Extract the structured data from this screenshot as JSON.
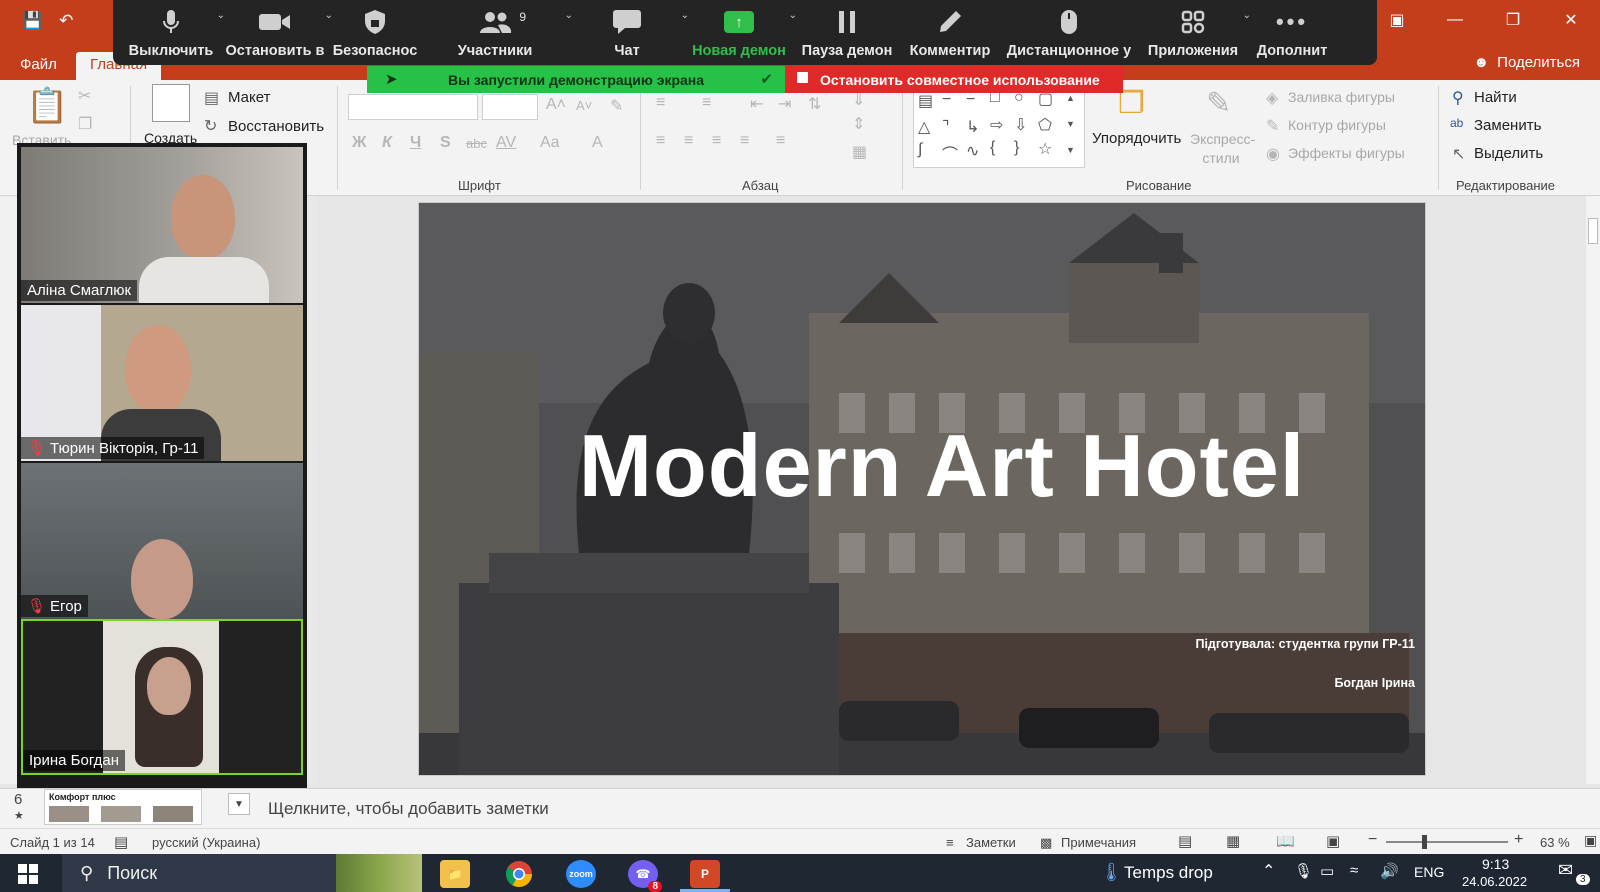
{
  "window": {
    "title_bar_color": "#c43e1c",
    "qat_icons": [
      "save-icon",
      "undo-icon"
    ],
    "controls": [
      "ribbon-display-icon",
      "minimize-icon",
      "restore-icon",
      "close-icon"
    ]
  },
  "zoom_toolbar": {
    "buttons": [
      {
        "label": "Выключить",
        "icon": "microphone-icon"
      },
      {
        "label": "Остановить в",
        "icon": "video-camera-icon"
      },
      {
        "label": "Безопаснос",
        "icon": "shield-icon"
      },
      {
        "label": "Участники",
        "icon": "participants-icon",
        "count": "9"
      },
      {
        "label": "Чат",
        "icon": "chat-icon"
      },
      {
        "label": "Новая демон",
        "icon": "share-screen-icon"
      },
      {
        "label": "Пауза демон",
        "icon": "pause-icon"
      },
      {
        "label": "Комментир",
        "icon": "annotate-pencil-icon"
      },
      {
        "label": "Дистанционное у",
        "icon": "remote-control-mouse-icon"
      },
      {
        "label": "Приложения",
        "icon": "apps-icon"
      },
      {
        "label": "Дополнит",
        "icon": "more-icon"
      }
    ]
  },
  "share_banner": {
    "sharing_text": "Вы запустили демонстрацию экрана",
    "stop_text": "Остановить совместное использование"
  },
  "ribbon_tabs": [
    "Файл",
    "Главная"
  ],
  "share_label": "Поделиться",
  "ribbon": {
    "clipboard": {
      "paste": "Вставить"
    },
    "slides": {
      "new": "Создать",
      "layout": "Макет",
      "reset": "Восстановить"
    },
    "font_group_label": "Шрифт",
    "paragraph_group_label": "Абзац",
    "font_buttons": [
      "Ж",
      "К",
      "Ч",
      "S",
      "abc",
      "AV",
      "Aa",
      "A"
    ],
    "drawing": {
      "arrange": "Упорядочить",
      "quick_styles": "Экспресс-стили",
      "fill": "Заливка фигуры",
      "outline": "Контур фигуры",
      "effects": "Эффекты фигуры",
      "group_label": "Рисование"
    },
    "editing": {
      "find": "Найти",
      "replace": "Заменить",
      "select": "Выделить",
      "group_label": "Редактирование"
    }
  },
  "participants": [
    {
      "name": "Аліна Смаглюк",
      "muted": false,
      "active": false
    },
    {
      "name": "Тюрин Вікторія, Гр-11",
      "muted": true,
      "active": false
    },
    {
      "name": "Егор",
      "muted": true,
      "active": false
    },
    {
      "name": "Ірина Богдан",
      "muted": false,
      "active": true
    }
  ],
  "slide": {
    "title": "Modern Art Hotel",
    "credit_line1": "Підготувала: студентка групи ГР-11",
    "credit_line2": "Богдан Ірина"
  },
  "thumbnail": {
    "number": "6",
    "caption": "Комфорт плюс"
  },
  "notes_placeholder": "Щелкните, чтобы добавить заметки",
  "status_bar": {
    "slide_info": "Слайд 1 из 14",
    "language": "русский (Украина)",
    "notes": "Заметки",
    "comments": "Примечания",
    "zoom": "63 %"
  },
  "taskbar": {
    "search_placeholder": "Поиск",
    "weather": "Temps drop",
    "language": "ENG",
    "time": "9:13",
    "date": "24.06.2022",
    "viber_badge": "8",
    "notifications": "3",
    "zoom_app_label": "zoom"
  }
}
